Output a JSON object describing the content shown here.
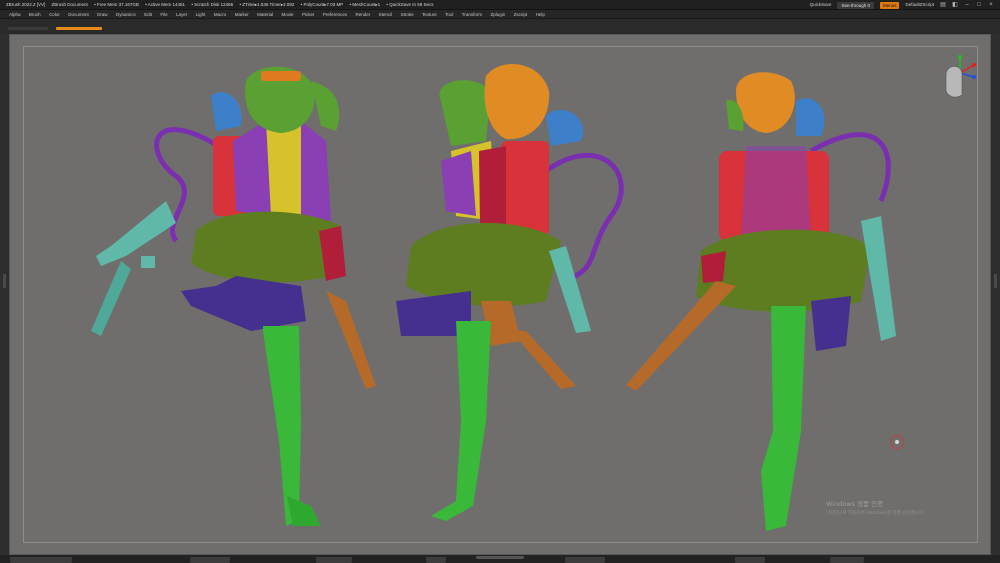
{
  "titlebar": {
    "app_title": "ZBrush 2022.2 [VV]",
    "document": "ZBrush Document",
    "free_mem": "• Free Mem 37.167GB",
    "active_mem": "• Active Mem 14461",
    "scratch_disk": "• Scratch Disk 12466",
    "ztime": "• ZTime▸1.536 Timer▸2.082",
    "polycount": "• PolyCount▸7.03 MP",
    "meshcount": "• MeshCount▸1",
    "quicksave_note": "• QuickSave In 59 Secs",
    "quicksave_button": "QuickSave",
    "see_through": "See-through 0",
    "menus_button": "Menus",
    "default_script": "DefaultZScript"
  },
  "menubar": {
    "items": [
      "Alpha",
      "Brush",
      "Color",
      "Document",
      "Draw",
      "Dynamics",
      "Edit",
      "File",
      "Layer",
      "Light",
      "Macro",
      "Marker",
      "Material",
      "Movie",
      "Picker",
      "Preferences",
      "Render",
      "Stencil",
      "Stroke",
      "Texture",
      "Tool",
      "Transform",
      "Zplugin",
      "Zscript",
      "Help"
    ]
  },
  "watermark": {
    "title": "Windows 정품 인증",
    "subtitle": "[설정]으로 이동하여 Windows를 정품 인증합니다."
  },
  "icons": {
    "navcube": "navigation-head-icon",
    "pivot": "transform-pivot-icon"
  },
  "colors": {
    "accent": "#e88b1a",
    "canvas": "#6f6e6d"
  }
}
